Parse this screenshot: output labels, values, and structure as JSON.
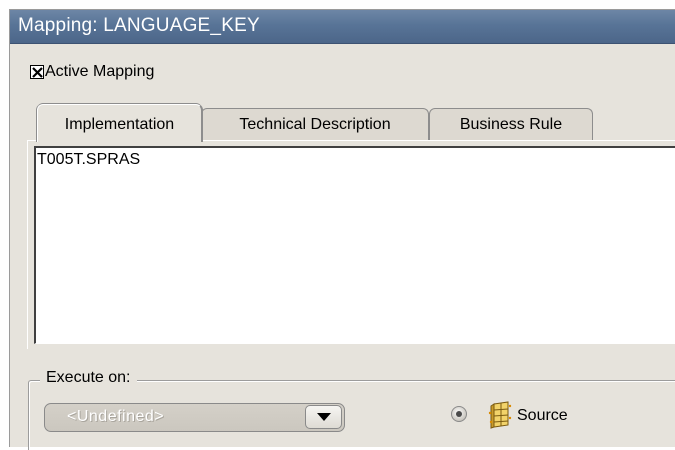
{
  "window": {
    "title": "Mapping: LANGUAGE_KEY"
  },
  "mapping": {
    "active_label": "Active Mapping",
    "active_checked": true
  },
  "tabs": [
    {
      "label": "Implementation",
      "selected": true
    },
    {
      "label": "Technical Description",
      "selected": false
    },
    {
      "label": "Business Rule",
      "selected": false
    }
  ],
  "implementation": {
    "text": "T005T.SPRAS"
  },
  "execute": {
    "group_label": "Execute on:",
    "combo_value": "<Undefined>",
    "combo_enabled": false,
    "radio_selected": true,
    "radio_icon": "source-table-icon",
    "radio_label": "Source"
  },
  "colors": {
    "title_bar": "#587497",
    "panel": "#e6e3dc"
  }
}
